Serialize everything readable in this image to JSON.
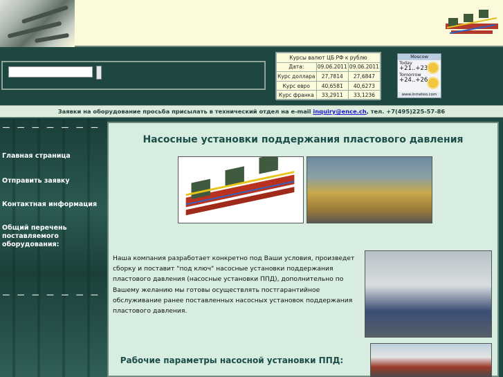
{
  "notice": {
    "text_before": "Заявки на оборудование просьба присылать в технический отдел на e-mail",
    "email": "inquiry@ence.ch",
    "text_after": ", тел. +7(495)225-57-86"
  },
  "search": {
    "value": "",
    "placeholder": ""
  },
  "currency": {
    "caption": "Курсы валют ЦБ РФ к рублю",
    "rows": [
      {
        "label": "Дата:",
        "v1": "09.06.2011",
        "v2": "09.06.2011"
      },
      {
        "label": "Курс доллара",
        "v1": "27,7814",
        "v2": "27,6847"
      },
      {
        "label": "Курс евро",
        "v1": "40,6581",
        "v2": "40,6273"
      },
      {
        "label": "Курс франка",
        "v1": "33,2911",
        "v2": "33,1236"
      }
    ]
  },
  "weather": {
    "city": "Moscow",
    "today_label": "Today",
    "today_temp": "+21..+23",
    "tomorrow_label": "Tomorrow",
    "tomorrow_temp": "+24..+26",
    "footer": "www.inmeteo.com"
  },
  "sidebar": {
    "divider_top": "— — — — — — —",
    "items": [
      {
        "label": "Главная страница"
      },
      {
        "label": "Отправить заявку"
      },
      {
        "label": "Контактная информация"
      },
      {
        "label": "Общий перечень поставляемого оборудования:"
      }
    ],
    "divider_bottom": "— — — — — — —"
  },
  "main": {
    "title": "Насосные установки поддержания пластового давления",
    "body": "Наша компания разработает конкретно под Ваши условия, произведет сборку и поставит \"под ключ\" насосные установки поддержания пластового давления (насосные установки ППД), дополнительно по Вашему желанию мы готовы осуществлять постгарантийное обслуживание ранее поставленных насосных установок поддержания пластового давления.",
    "subtitle": "Рабочие параметры насосной установки ППД:"
  },
  "colors": {
    "header_bg": "#fbfadb",
    "band_bg": "#1e4741",
    "content_bg": "#d6eddf",
    "title_color": "#1b4d49",
    "email_link": "#1b1bd0"
  }
}
